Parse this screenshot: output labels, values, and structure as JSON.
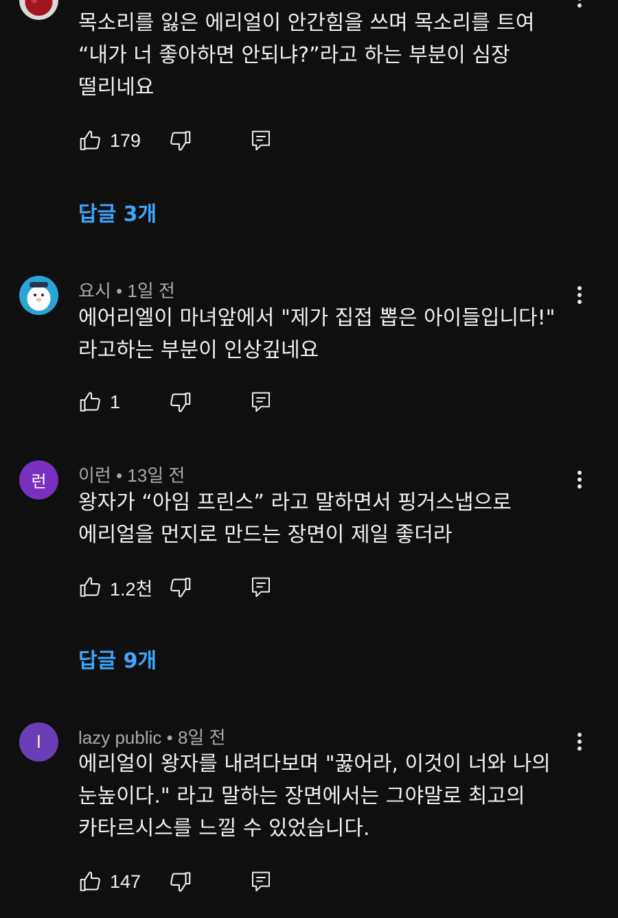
{
  "comments": [
    {
      "author": "",
      "time": "",
      "text": "목소리를 잃은 에리얼이 안간힘을 쓰며 목소리를 트여\n“내가 너 좋아하면 안되냐?”라고 하는 부분이 심장\n떨리네요",
      "likes": "179",
      "replies": "답글 3개",
      "avatar_color": "#8b1a1a"
    },
    {
      "author": "요시",
      "time": "1일 전",
      "text": "에어리엘이 마녀앞에서 \"제가 집접 뽑은 아이들입니다!\"\n라고하는 부분이 인상깊네요",
      "likes": "1",
      "avatar_color": "#2aa4d6"
    },
    {
      "author": "이런",
      "time": "13일 전",
      "initial": "런",
      "text": "왕자가 “아임 프린스” 라고 말하면서 핑거스냅으로\n에리얼을 먼지로 만드는 장면이 제일 좋더라",
      "likes": "1.2천",
      "replies": "답글 9개",
      "avatar_color": "#7b2fbe"
    },
    {
      "author": "lazy public",
      "time": "8일 전",
      "initial": "l",
      "text": "에리얼이 왕자를 내려다보며 \"꿇어라, 이것이 너와 나의\n눈높이다.\" 라고 말하는 장면에서는 그야말로 최고의\n카타르시스를 느낄 수 있었습니다.",
      "likes": "147",
      "avatar_color": "#6a3fb5"
    }
  ],
  "meta_separator": " • "
}
